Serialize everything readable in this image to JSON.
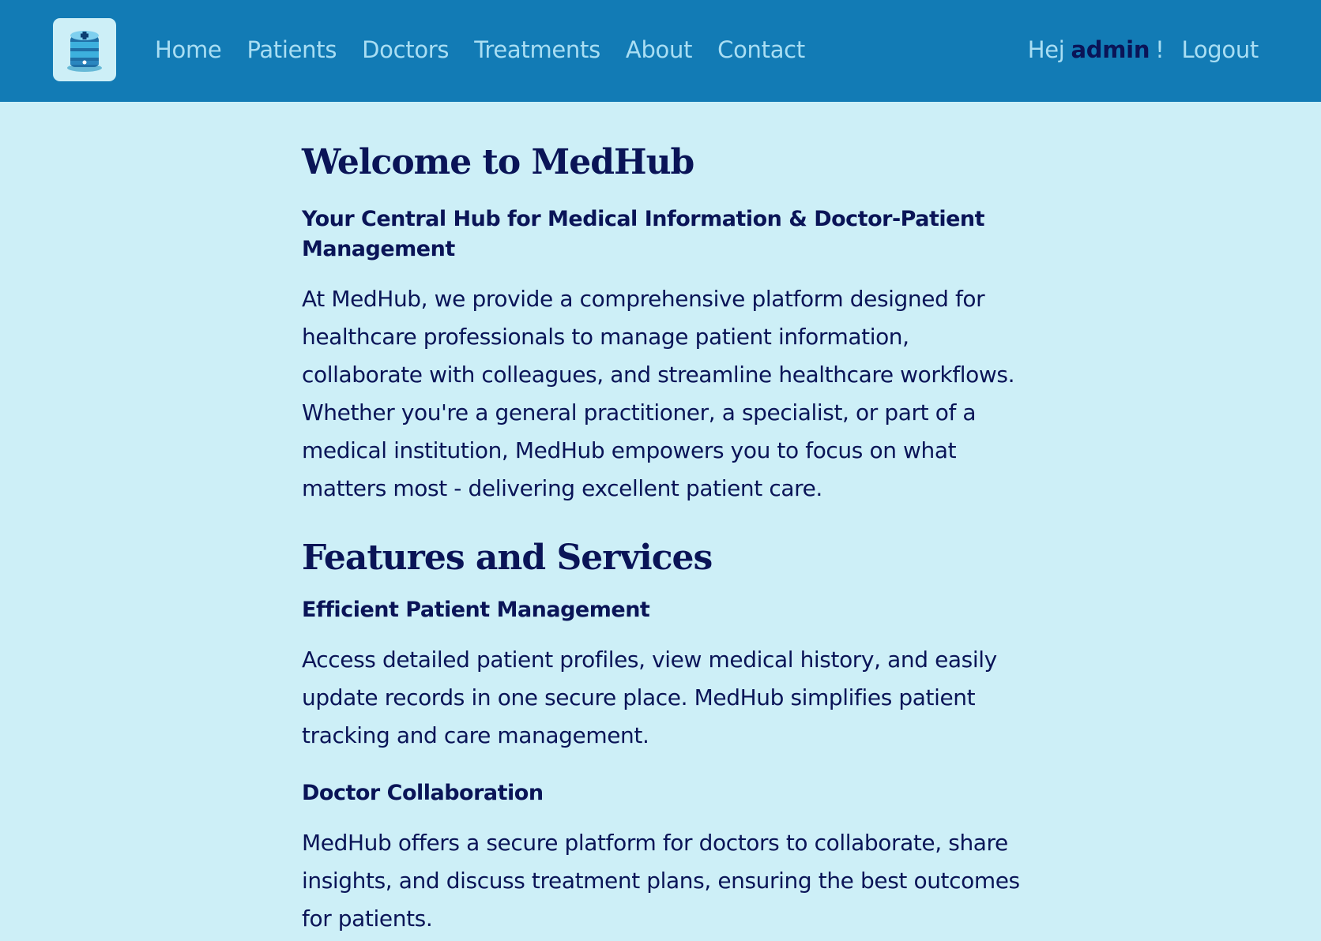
{
  "nav": {
    "logo_alt": "database-logo-icon",
    "links": [
      {
        "label": "Home"
      },
      {
        "label": "Patients"
      },
      {
        "label": "Doctors"
      },
      {
        "label": "Treatments"
      },
      {
        "label": "About"
      },
      {
        "label": "Contact"
      }
    ],
    "greeting_prefix": "Hej",
    "username": "admin",
    "greeting_suffix": "!",
    "logout_label": "Logout"
  },
  "main": {
    "title": "Welcome to MedHub",
    "subtitle": "Your Central Hub for Medical Information & Doctor-Patient Management",
    "intro": "At MedHub, we provide a comprehensive platform designed for healthcare professionals to manage patient information, collaborate with colleagues, and streamline healthcare workflows. Whether you're a general practitioner, a specialist, or part of a medical institution, MedHub empowers you to focus on what matters most - delivering excellent patient care.",
    "features_title": "Features and Services",
    "features": [
      {
        "title": "Efficient Patient Management",
        "description": "Access detailed patient profiles, view medical history, and easily update records in one secure place. MedHub simplifies patient tracking and care management."
      },
      {
        "title": "Doctor Collaboration",
        "description": "MedHub offers a secure platform for doctors to collaborate, share insights, and discuss treatment plans, ensuring the best outcomes for patients."
      }
    ]
  },
  "colors": {
    "navbar_bg": "#127bb5",
    "page_bg": "#cdeff7",
    "nav_text": "#a9def3",
    "heading_text": "#0a1457"
  }
}
